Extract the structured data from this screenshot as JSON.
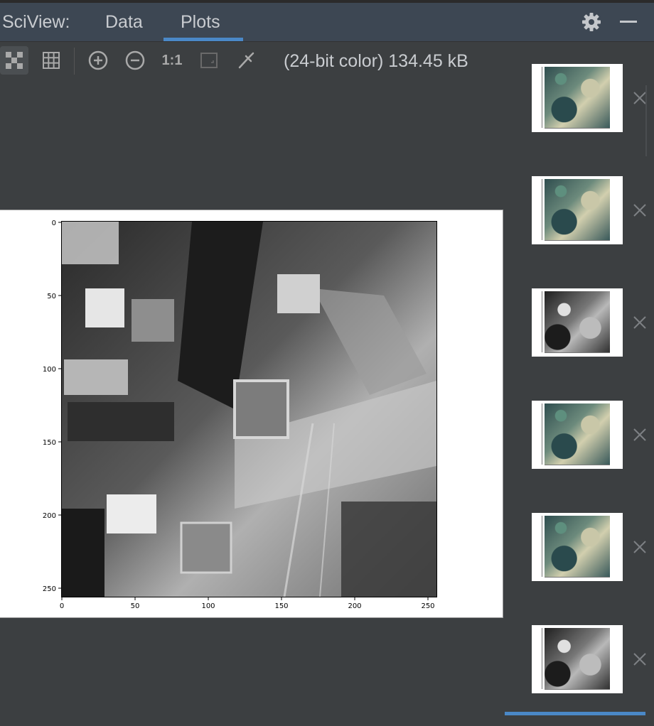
{
  "header": {
    "title": "SciView:",
    "tabs": [
      {
        "label": "Data",
        "active": false
      },
      {
        "label": "Plots",
        "active": true
      }
    ],
    "settings_icon": "gear-icon",
    "minimize_icon": "minimize-icon"
  },
  "toolbar": {
    "buttons": [
      {
        "name": "chessboard-icon",
        "active": true
      },
      {
        "name": "grid-icon",
        "active": false
      },
      {
        "name": "zoom-in-icon",
        "active": false
      },
      {
        "name": "zoom-out-icon",
        "active": false
      },
      {
        "name": "actual-size",
        "label": "1:1"
      },
      {
        "name": "fit-to-window-icon",
        "active": false,
        "disabled": true
      },
      {
        "name": "color-picker-icon",
        "active": false
      }
    ],
    "image_info": "(24-bit color) 134.45 kB"
  },
  "plot": {
    "x_ticks": [
      "0",
      "50",
      "100",
      "150",
      "200",
      "250"
    ],
    "y_ticks": [
      "0",
      "50",
      "100",
      "150",
      "200",
      "250"
    ]
  },
  "thumbnails": [
    {
      "kind": "color"
    },
    {
      "kind": "color"
    },
    {
      "kind": "gray"
    },
    {
      "kind": "color"
    },
    {
      "kind": "color"
    },
    {
      "kind": "gray"
    }
  ],
  "colors": {
    "accent": "#4a88c7",
    "panel_bg": "#3c3f41",
    "header_bg": "#3d4753"
  }
}
